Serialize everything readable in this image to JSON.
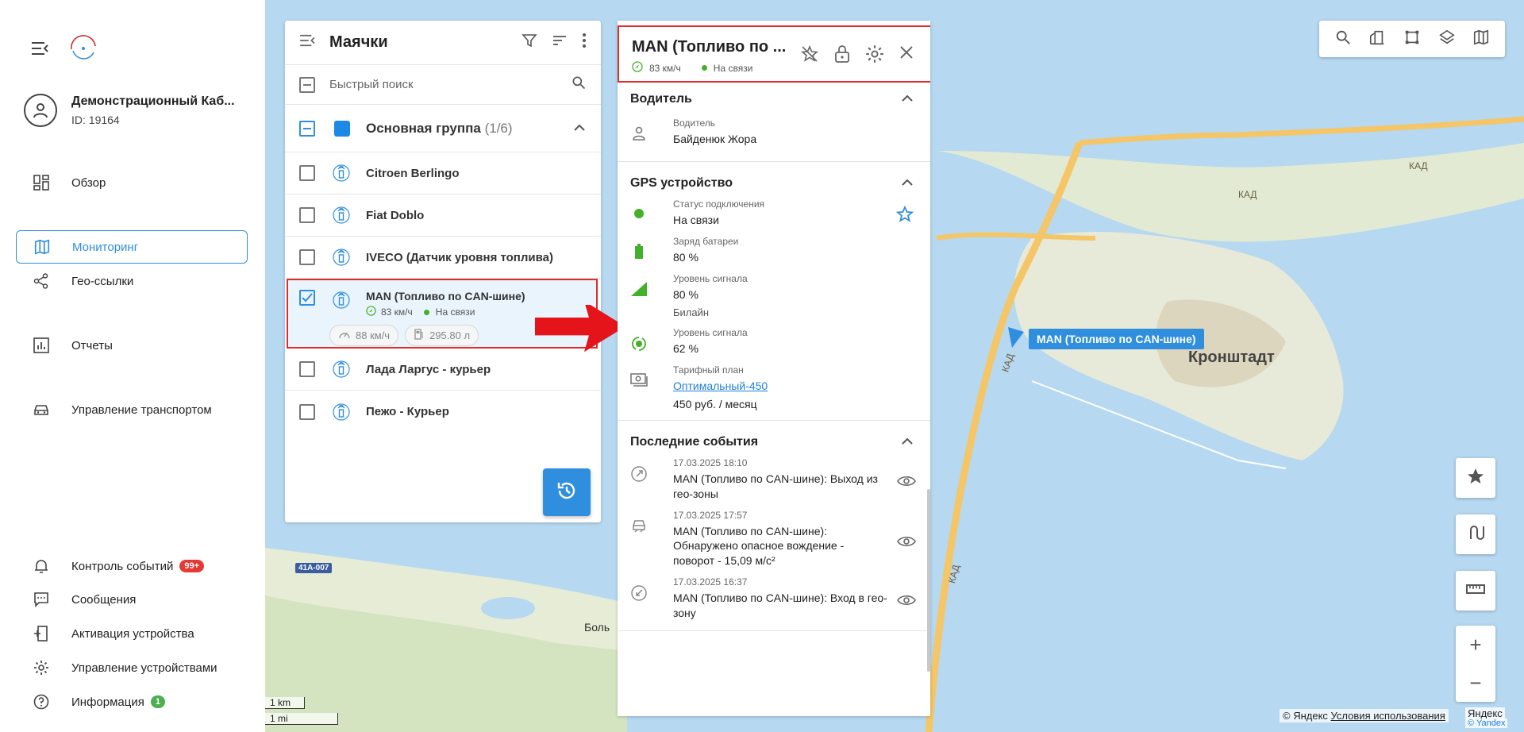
{
  "sidebar": {
    "account_name": "Демонстрационный Каб...",
    "account_id": "ID: 19164",
    "nav": {
      "overview": "Обзор",
      "monitoring": "Мониторинг",
      "geolinks": "Гео-ссылки",
      "reports": "Отчеты",
      "transport": "Управление транспортом",
      "events": "Контроль событий",
      "events_badge": "99+",
      "messages": "Сообщения",
      "activation": "Активация устройства",
      "devices": "Управление устройствами",
      "info": "Информация",
      "info_badge": "1"
    }
  },
  "beacons": {
    "title": "Маячки",
    "search_placeholder": "Быстрый поиск",
    "group_name": "Основная группа",
    "group_count": "(1/6)",
    "group_color": "#1e88e5",
    "devices": [
      {
        "name": "Citroen Berlingo"
      },
      {
        "name": "Fiat Doblo"
      },
      {
        "name": "IVECO (Датчик уровня топлива)"
      },
      {
        "name": "MAN (Топливо по CAN-шине)",
        "speed": "83 км/ч",
        "status": "На связи",
        "chip_speed": "88 км/ч",
        "chip_fuel": "295.80 л"
      },
      {
        "name": "Лада Ларгус - курьер"
      },
      {
        "name": "Пежо - Курьер"
      }
    ]
  },
  "details": {
    "title": "MAN (Топливо по ...",
    "speed": "83 км/ч",
    "status": "На связи",
    "driver_section": "Водитель",
    "driver_label": "Водитель",
    "driver_value": "Байденюк Жора",
    "gps_section": "GPS устройство",
    "conn_label": "Статус подключения",
    "conn_value": "На связи",
    "battery_label": "Заряд батареи",
    "battery_value": "80 %",
    "signal_label": "Уровень сигнала",
    "signal_value": "80 %",
    "operator": "Билайн",
    "gps_signal_label": "Уровень сигнала",
    "gps_signal_value": "62 %",
    "tariff_label": "Тарифный план",
    "tariff_link": "Оптимальный-450",
    "tariff_price": "450 руб. / месяц",
    "events_section": "Последние события",
    "events": [
      {
        "time": "17.03.2025 18:10",
        "text": "MAN (Топливо по CAN-шине): Выход из гео-зоны"
      },
      {
        "time": "17.03.2025 17:57",
        "text": "MAN (Топливо по CAN-шине): Обнаружено опасное вождение - поворот - 15,09 м/с²"
      },
      {
        "time": "17.03.2025 16:37",
        "text": "MAN (Топливо по CAN-шине): Вход в гео-зону"
      }
    ]
  },
  "map": {
    "marker_label": "MAN (Топливо по CAN-шине)",
    "city": "Кронштадт",
    "road_kad": "КАД",
    "road_shield": "41А-007",
    "place_partial": "Боль",
    "scale_km": "1 km",
    "scale_mi": "1 mi",
    "copyright_prefix": "© Яндекс",
    "terms": "Условия использования",
    "yandex": "Яндекс",
    "yandex_sub": "© Yandex"
  },
  "colors": {
    "accent": "#2f8fde",
    "online": "#43b02a",
    "highlight": "#e32b2b"
  }
}
